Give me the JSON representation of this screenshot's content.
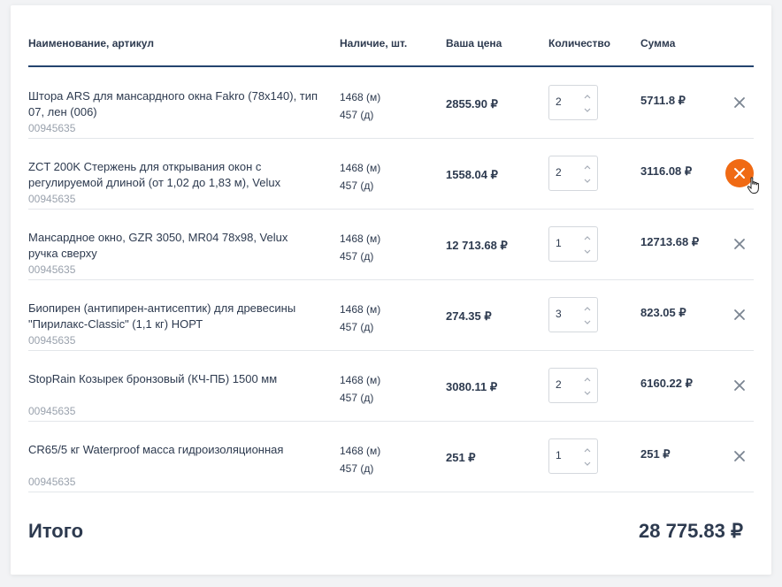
{
  "table": {
    "headers": {
      "name": "Наименование, артикул",
      "stock": "Наличие, шт.",
      "price": "Ваша цена",
      "qty": "Количество",
      "sum": "Сумма"
    },
    "rows": [
      {
        "name": "Штора ARS для мансардного окна Fakro (78x140), тип 07, лен (006)",
        "sku": "00945635",
        "stock_m": "1468 (м)",
        "stock_d": "457 (д)",
        "price": "2855.90 ₽",
        "qty": "2",
        "sum": "5711.8 ₽"
      },
      {
        "name": "ZCT 200K Стержень для открывания окон с регулируемой длиной (от 1,02 до 1,83 м), Velux",
        "sku": "00945635",
        "stock_m": "1468 (м)",
        "stock_d": "457 (д)",
        "price": "1558.04 ₽",
        "qty": "2",
        "sum": "3116.08 ₽"
      },
      {
        "name": "Мансардное окно, GZR 3050, MR04 78x98, Velux ручка сверху",
        "sku": "00945635",
        "stock_m": "1468 (м)",
        "stock_d": "457 (д)",
        "price": "12 713.68 ₽",
        "qty": "1",
        "sum": "12713.68 ₽"
      },
      {
        "name": "Биопирен (антипирен-антисептик) для древесины \"Пирилакс-Classic\" (1,1 кг) НОРТ",
        "sku": "00945635",
        "stock_m": "1468 (м)",
        "stock_d": "457 (д)",
        "price": "274.35 ₽",
        "qty": "3",
        "sum": "823.05 ₽"
      },
      {
        "name": "StopRain Козырек бронзовый (КЧ-ПБ) 1500 мм",
        "sku": "00945635",
        "stock_m": "1468 (м)",
        "stock_d": "457 (д)",
        "price": "3080.11 ₽",
        "qty": "2",
        "sum": "6160.22 ₽"
      },
      {
        "name": "CR65/5 кг Waterproof масса гидроизоляционная",
        "sku": "00945635",
        "stock_m": "1468 (м)",
        "stock_d": "457 (д)",
        "price": "251 ₽",
        "qty": "1",
        "sum": "251 ₽"
      }
    ]
  },
  "total": {
    "label": "Итого",
    "value": "28 775.83 ₽"
  },
  "colors": {
    "accent": "#f06a14",
    "header_line": "#24446f",
    "text": "#2d3a4f",
    "muted": "#9aa2ad"
  },
  "icons": {
    "delete": "close-icon",
    "qty_up": "chevron-up-icon",
    "qty_down": "chevron-down-icon",
    "cursor": "hand-pointer-icon"
  }
}
